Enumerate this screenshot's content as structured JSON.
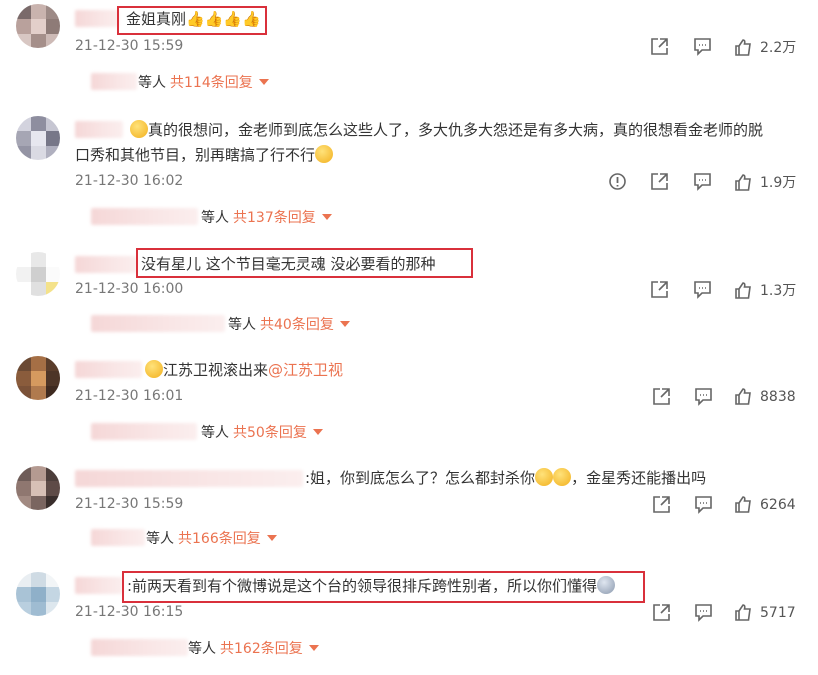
{
  "colors": {
    "accent": "#eb7350",
    "highlight": "#d9303b",
    "meta": "#777777"
  },
  "comments": [
    {
      "text": "金姐真刚👍👍👍👍",
      "time": "21-12-30 15:59",
      "share_icon": "share-icon",
      "comment_icon": "comment-icon",
      "like_count": "2.2万",
      "reply_suffix": "等人",
      "reply_count": "共114条回复"
    },
    {
      "text_line1": "真的很想问，金老师到底怎么这些人了，多大仇多大怨还是有多大病，真的很想看金老师的脱",
      "text_line2": "口秀和其他节目，别再瞎搞了行不行",
      "time": "21-12-30 16:02",
      "like_count": "1.9万",
      "reply_suffix": "等人",
      "reply_count": "共137条回复"
    },
    {
      "text": "没有星儿 这个节目毫无灵魂 没必要看的那种",
      "time": "21-12-30 16:00",
      "like_count": "1.3万",
      "reply_suffix": "等人",
      "reply_count": "共40条回复"
    },
    {
      "text": "江苏卫视滚出来",
      "mention": "@江苏卫视",
      "time": "21-12-30 16:01",
      "like_count": "8838",
      "reply_suffix": "等人",
      "reply_count": "共50条回复"
    },
    {
      "text_a": ":姐，你到底怎么了？怎么都封杀你",
      "text_b": "，金星秀还能播出吗",
      "time": "21-12-30 15:59",
      "like_count": "6264",
      "reply_suffix": "等人",
      "reply_count": "共166条回复"
    },
    {
      "text": ":前两天看到有个微博说是这个台的领导很排斥跨性别者，所以你们懂得",
      "time": "21-12-30 16:15",
      "like_count": "5717",
      "reply_suffix": "等人",
      "reply_count": "共162条回复"
    }
  ]
}
